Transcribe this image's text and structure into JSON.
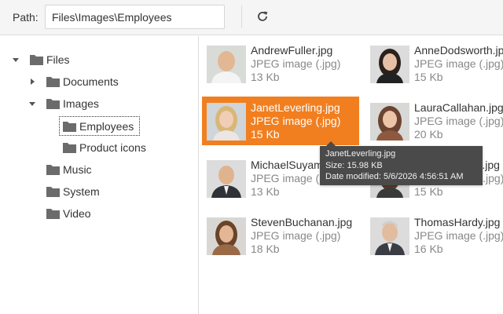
{
  "toolbar": {
    "path_label": "Path:",
    "path_value": "Files\\Images\\Employees",
    "refresh_icon": "refresh-icon"
  },
  "tree": {
    "nodes": [
      {
        "label": "Files",
        "state": "expanded",
        "icon": "folder-icon"
      },
      {
        "label": "Documents",
        "state": "collapsed",
        "icon": "folder-icon"
      },
      {
        "label": "Images",
        "state": "expanded",
        "icon": "folder-icon"
      },
      {
        "label": "Employees",
        "state": "selected",
        "icon": "folder-icon"
      },
      {
        "label": "Product icons",
        "state": "leaf",
        "icon": "folder-icon"
      },
      {
        "label": "Music",
        "state": "leaf",
        "icon": "folder-icon"
      },
      {
        "label": "System",
        "state": "leaf",
        "icon": "folder-icon"
      },
      {
        "label": "Video",
        "state": "leaf",
        "icon": "folder-icon"
      }
    ]
  },
  "items": [
    {
      "name": "AndrewFuller.jpg",
      "type": "JPEG image (.jpg)",
      "size": "13 Kb",
      "selected": false
    },
    {
      "name": "AnneDodsworth.jpg",
      "type": "JPEG image (.jpg)",
      "size": "15 Kb",
      "selected": false
    },
    {
      "name": "JanetLeverling.jpg",
      "type": "JPEG image (.jpg)",
      "size": "15 Kb",
      "selected": true
    },
    {
      "name": "LauraCallahan.jpg",
      "type": "JPEG image (.jpg)",
      "size": "20 Kb",
      "selected": false
    },
    {
      "name": "MichaelSuyama.jpg",
      "type": "JPEG image (.jpg)",
      "size": "13 Kb",
      "selected": false
    },
    {
      "name": "NancyDavolio.jpg",
      "type": "JPEG image (.jpg)",
      "size": "15 Kb",
      "selected": false
    },
    {
      "name": "StevenBuchanan.jpg",
      "type": "JPEG image (.jpg)",
      "size": "18 Kb",
      "selected": false
    },
    {
      "name": "ThomasHardy.jpg",
      "type": "JPEG image (.jpg)",
      "size": "16 Kb",
      "selected": false
    }
  ],
  "tooltip": {
    "name": "JanetLeverling.jpg",
    "size": "Size: 15.98 KB",
    "modified": "Date modified: 5/6/2026 4:56:51 AM"
  },
  "colors": {
    "accent": "#f17f20",
    "folder": "#6b6b6b",
    "tooltip_bg": "#4a4a4a"
  }
}
